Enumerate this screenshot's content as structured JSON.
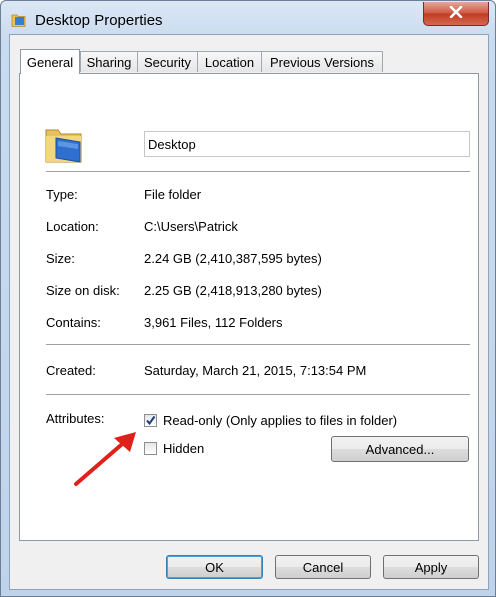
{
  "window": {
    "title": "Desktop Properties",
    "close_icon": "close-icon"
  },
  "tabs": [
    {
      "label": "General",
      "active": true
    },
    {
      "label": "Sharing",
      "active": false
    },
    {
      "label": "Security",
      "active": false
    },
    {
      "label": "Location",
      "active": false
    },
    {
      "label": "Previous Versions",
      "active": false
    }
  ],
  "general": {
    "folder_icon": "folder-icon",
    "name_value": "Desktop",
    "type_label": "Type:",
    "type_value": "File folder",
    "location_label": "Location:",
    "location_value": "C:\\Users\\Patrick",
    "size_label": "Size:",
    "size_value": "2.24 GB (2,410,387,595 bytes)",
    "size_on_disk_label": "Size on disk:",
    "size_on_disk_value": "2.25 GB (2,418,913,280 bytes)",
    "contains_label": "Contains:",
    "contains_value": "3,961 Files, 112 Folders",
    "created_label": "Created:",
    "created_value": "Saturday, March 21, 2015, 7:13:54 PM",
    "attributes_label": "Attributes:",
    "readonly_label": "Read-only (Only applies to files in folder)",
    "readonly_checked": true,
    "hidden_label": "Hidden",
    "hidden_checked": false,
    "advanced_label": "Advanced..."
  },
  "buttons": {
    "ok": "OK",
    "cancel": "Cancel",
    "apply": "Apply"
  },
  "annotation": {
    "arrow_color": "#e0201a"
  }
}
